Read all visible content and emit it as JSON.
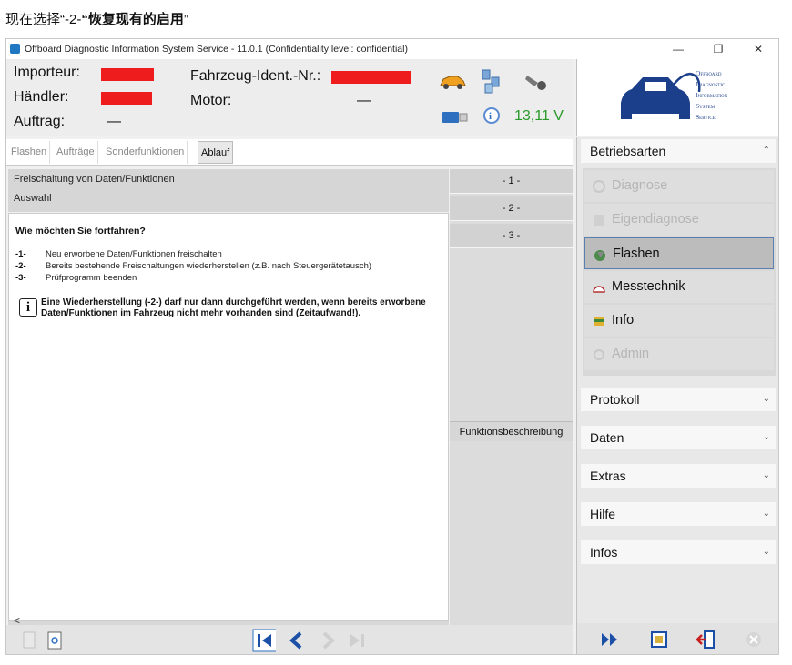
{
  "caption": {
    "prefix": "现在选择“-2-",
    "bold": "“恢复现有的启用",
    "suffix": "”"
  },
  "window": {
    "title": "Offboard Diagnostic Information System Service - 11.0.1 (Confidentiality level: confidential)",
    "minimize": "—",
    "maximize": "❐",
    "close": "✕"
  },
  "header": {
    "importeur_label": "Importeur:",
    "haendler_label": "Händler:",
    "auftrag_label": "Auftrag:",
    "auftrag_value": "—",
    "fin_label": "Fahrzeug-Ident.-Nr.:",
    "motor_label": "Motor:",
    "motor_value": "—",
    "voltage": "13,11 V",
    "redaction_color": "#ee1c1c"
  },
  "logo": {
    "lines": [
      "Offboard",
      "Diagnostic",
      "Information",
      "System",
      "Service"
    ]
  },
  "tabs": [
    {
      "label": "Flashen",
      "active": false
    },
    {
      "label": "Aufträge",
      "active": false
    },
    {
      "label": "Sonderfunktionen",
      "active": false
    },
    {
      "label": "Ablauf",
      "active": true
    }
  ],
  "section": {
    "title": "Freischaltung von Daten/Funktionen",
    "subtitle": "Auswahl"
  },
  "content": {
    "question": "Wie möchten Sie fortfahren?",
    "options": [
      {
        "num": "-1-",
        "text": "Neu erworbene Daten/Funktionen freischalten"
      },
      {
        "num": "-2-",
        "text": "Bereits bestehende Freischaltungen wiederherstellen (z.B. nach Steuergerätetausch)"
      },
      {
        "num": "-3-",
        "text": "Prüfprogramm beenden"
      }
    ],
    "note": "Eine Wiederherstellung (-2-) darf nur dann durchgeführt werden, wenn bereits erworbene Daten/Funktionen im Fahrzeug nicht mehr vorhanden sind (Zeitaufwand!).",
    "note_icon": "i"
  },
  "steps": [
    "- 1 -",
    "- 2 -",
    "- 3 -"
  ],
  "function_label": "Funktionsbeschreibung",
  "scroll_left": "<",
  "right_panel": {
    "betriebsarten": "Betriebsarten",
    "modes": [
      {
        "label": "Diagnose",
        "state": "disabled",
        "icon": "stethoscope-icon"
      },
      {
        "label": "Eigendiagnose",
        "state": "disabled",
        "icon": "book-icon"
      },
      {
        "label": "Flashen",
        "state": "active",
        "icon": "flash-icon"
      },
      {
        "label": "Messtechnik",
        "state": "enabled",
        "icon": "gauge-icon"
      },
      {
        "label": "Info",
        "state": "enabled",
        "icon": "info-book-icon"
      },
      {
        "label": "Admin",
        "state": "disabled",
        "icon": "admin-icon"
      }
    ],
    "sections": [
      "Protokoll",
      "Daten",
      "Extras",
      "Hilfe",
      "Infos"
    ],
    "collapse_symbol": "⌃",
    "expand_symbol": "⌄"
  }
}
